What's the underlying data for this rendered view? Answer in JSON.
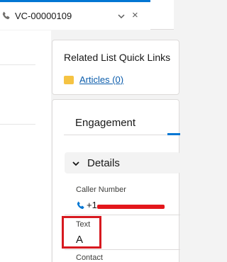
{
  "tab": {
    "title": "VC-00000109",
    "icons": {
      "phone": "phone-icon",
      "chevron": "chevron-down-icon",
      "close": "close-icon"
    },
    "close_glyph": "×"
  },
  "related_list": {
    "title": "Related List Quick Links",
    "articles_link": "Articles (0)",
    "articles_icon": "articles-icon"
  },
  "engagement": {
    "tab_label": "Engagement",
    "section_title": "Details",
    "fields": {
      "caller_number": {
        "label": "Caller Number",
        "value_prefix": "+1"
      },
      "text": {
        "label": "Text",
        "value": "A"
      },
      "contact": {
        "label": "Contact"
      }
    }
  },
  "colors": {
    "brand_blue": "#0176d3",
    "link_blue": "#0b5cab",
    "highlight_red": "#d7191f",
    "redaction_red": "#e3161b"
  }
}
